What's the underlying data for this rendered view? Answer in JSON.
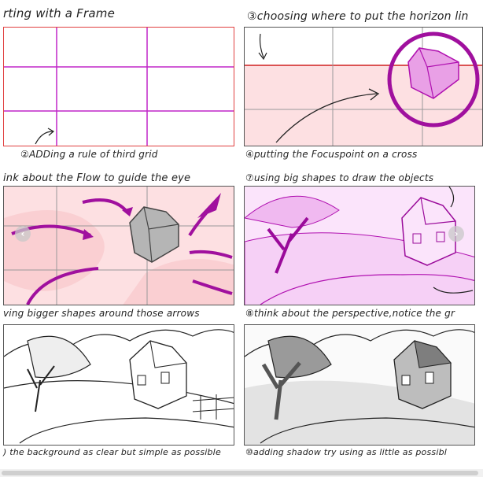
{
  "captions": {
    "c1": "rting with a Frame",
    "c2": "②ADDing a rule of third grid",
    "c3": "③choosing where to put the horizon lin",
    "c4": "④putting the Focuspoint on a cross",
    "c5": "ink about the Flow to guide the eye",
    "c6": "ving bigger shapes around those arrows",
    "c7": "⑦using big shapes to draw the objects",
    "c8": "⑧think about the perspective,notice the gr",
    "c9": ") the background as clear but simple as possible",
    "c10": "⑩adding shadow try using as little as possibl"
  },
  "carousel": {
    "prev_icon": "‹",
    "next_icon": "›"
  },
  "colors": {
    "grid_magenta": "#c026c8",
    "frame_red": "#e04040",
    "pink_fill": "#fde0e2",
    "arrow_purple": "#a0109e"
  }
}
